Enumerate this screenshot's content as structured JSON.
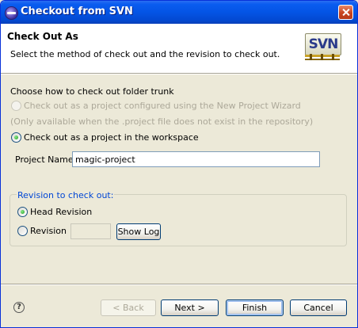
{
  "window": {
    "title": "Checkout from SVN"
  },
  "banner": {
    "title": "Check Out As",
    "description": "Select the method of check out and the revision to check out.",
    "logo_text": "SVN"
  },
  "method": {
    "heading": "Choose how to check out folder trunk",
    "option_wizard": "Check out as a project configured using the New Project Wizard",
    "wizard_note": "(Only available when the .project file does not exist in the repository)",
    "option_workspace": "Check out as a project in the workspace",
    "selected": "workspace"
  },
  "project": {
    "label": "Project Name:",
    "value": "magic-project"
  },
  "revision": {
    "group_title": "Revision to check out:",
    "head_label": "Head Revision",
    "revision_label": "Revision",
    "revision_value": "",
    "show_log_label": "Show Log",
    "selected": "head"
  },
  "footer": {
    "help_glyph": "?",
    "back_label": "< Back",
    "next_label": "Next >",
    "finish_label": "Finish",
    "cancel_label": "Cancel"
  },
  "colors": {
    "titlebar": "#0454e5",
    "dialog_bg": "#ece9d8",
    "group_title": "#0046d5",
    "radio_dot": "#21a121"
  },
  "icons": {
    "title": "eclipse-icon",
    "close": "close-icon",
    "logo": "svn-logo",
    "help": "help-icon"
  }
}
